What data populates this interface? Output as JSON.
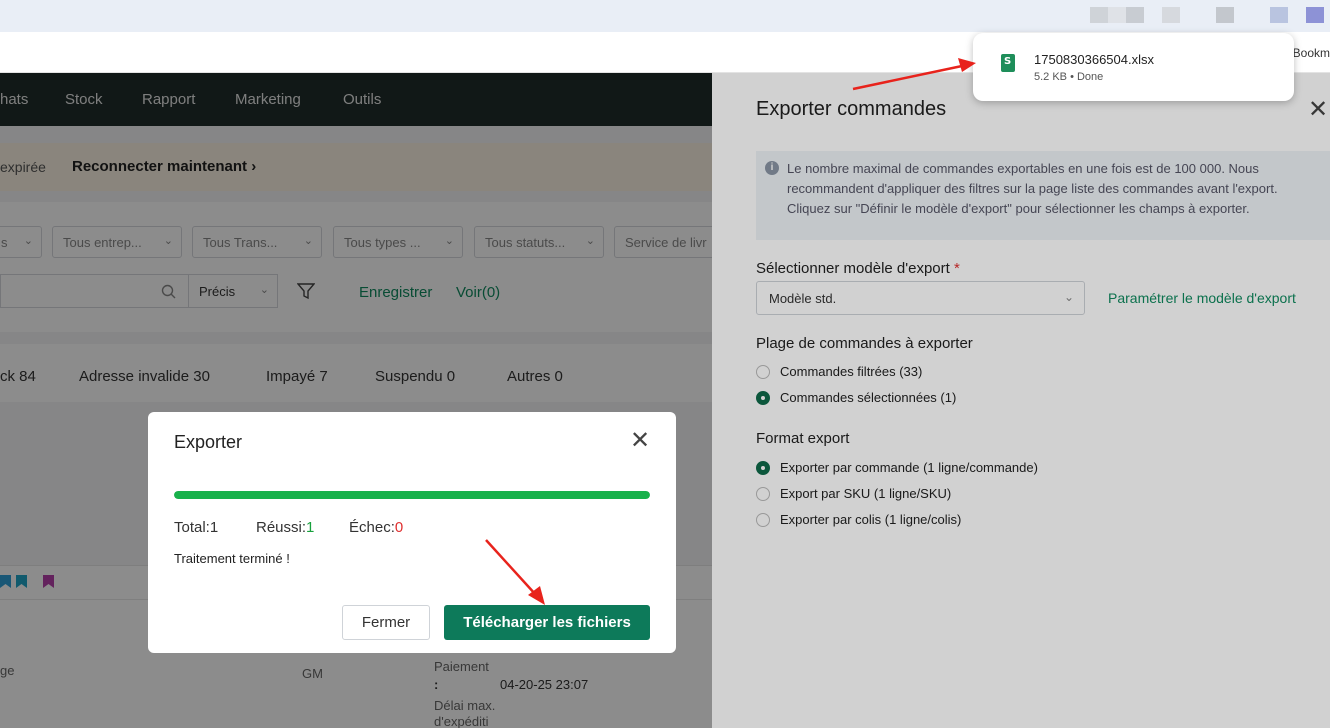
{
  "browser": {
    "bookmarks_label": "Bookm"
  },
  "app_nav": {
    "items": [
      "hats",
      "Stock",
      "Rapport",
      "Marketing",
      "Outils"
    ]
  },
  "banner": {
    "expired_text": "expirée",
    "reconnect_link": "Reconnecter maintenant"
  },
  "filters": {
    "selects": [
      "s",
      "Tous entrep...",
      "Tous Trans...",
      "Tous types ...",
      "Tous statuts...",
      "Service de livr"
    ],
    "precision": "Précis",
    "save_link": "Enregistrer",
    "view_link": "Voir(0)"
  },
  "status_tabs": [
    "ck 84",
    "Adresse invalide 30",
    "Impayé 7",
    "Suspendu 0",
    "Autres 0"
  ],
  "order_row": {
    "col1": "ge",
    "gm": "GM",
    "payment_label": "Paiement",
    "colon": ":",
    "payment_date": "04-20-25 23:07",
    "delay_label_1": "Délai max.",
    "delay_label_2": "d'expéditi"
  },
  "drawer": {
    "title": "Exporter commandes",
    "info_text": "Le nombre maximal de commandes exportables en une fois est de 100 000. Nous recommandent d'appliquer des filtres sur la page liste des commandes avant l'export. Cliquez sur \"Définir le modèle d'export\" pour sélectionner les champs à exporter.",
    "model_label": "Sélectionner modèle d'export",
    "required_mark": "*",
    "model_value": "Modèle std.",
    "param_link": "Paramétrer le modèle d'export",
    "range_label": "Plage de commandes à exporter",
    "range_options": [
      {
        "label": "Commandes filtrées (33)",
        "selected": false
      },
      {
        "label": "Commandes sélectionnées (1)",
        "selected": true
      }
    ],
    "format_label": "Format export",
    "format_options": [
      {
        "label": "Exporter par commande (1 ligne/commande)",
        "selected": true
      },
      {
        "label": "Export par SKU (1 ligne/SKU)",
        "selected": false
      },
      {
        "label": "Exporter par colis (1 ligne/colis)",
        "selected": false
      }
    ]
  },
  "download": {
    "filename": "1750830366504.xlsx",
    "status": "5.2 KB • Done"
  },
  "modal": {
    "title": "Exporter",
    "progress": 1.0,
    "total_label": "Total:",
    "total_value": "1",
    "success_label": "Réussi:",
    "success_value": "1",
    "fail_label": "Échec:",
    "fail_value": "0",
    "done_text": "Traitement terminé !",
    "close_button": "Fermer",
    "download_button": "Télécharger les fichiers"
  },
  "colors": {
    "accent": "#0d7a5a",
    "progress": "#18b14b",
    "annotation_arrow": "#e8231c"
  }
}
